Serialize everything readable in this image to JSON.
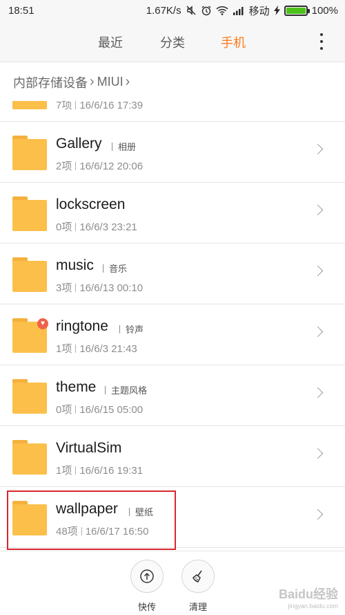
{
  "status_bar": {
    "time": "18:51",
    "speed": "1.67K/s",
    "carrier": "移动",
    "battery": "100%",
    "battery_level": 1.0,
    "battery_color": "#4cc21a"
  },
  "tabs": [
    {
      "label": "最近",
      "active": false
    },
    {
      "label": "分类",
      "active": false
    },
    {
      "label": "手机",
      "active": true
    }
  ],
  "accent_color": "#fd7a1c",
  "breadcrumb": {
    "root": "内部存储设备",
    "current": "MIUI"
  },
  "folders": [
    {
      "name": "",
      "alias": "",
      "count": "7项",
      "date": "16/6/16 17:39"
    },
    {
      "name": "Gallery",
      "alias": "相册",
      "count": "2项",
      "date": "16/6/12 20:06"
    },
    {
      "name": "lockscreen",
      "alias": "",
      "count": "0项",
      "date": "16/6/3 23:21"
    },
    {
      "name": "music",
      "alias": "音乐",
      "count": "3项",
      "date": "16/6/13 00:10"
    },
    {
      "name": "ringtone",
      "alias": "铃声",
      "count": "1项",
      "date": "16/6/3 21:43",
      "badge": "heart-icon"
    },
    {
      "name": "theme",
      "alias": "主题风格",
      "count": "0项",
      "date": "16/6/15 05:00"
    },
    {
      "name": "VirtualSim",
      "alias": "",
      "count": "1项",
      "date": "16/6/16 19:31"
    },
    {
      "name": "wallpaper",
      "alias": "壁纸",
      "count": "48项",
      "date": "16/6/17 16:50",
      "highlighted": true
    }
  ],
  "bottom_actions": [
    {
      "label": "快传",
      "icon": "upload-icon"
    },
    {
      "label": "清理",
      "icon": "broom-icon"
    }
  ],
  "watermark": {
    "text": "Baidu经验",
    "sub": "jingyan.baidu.com"
  }
}
